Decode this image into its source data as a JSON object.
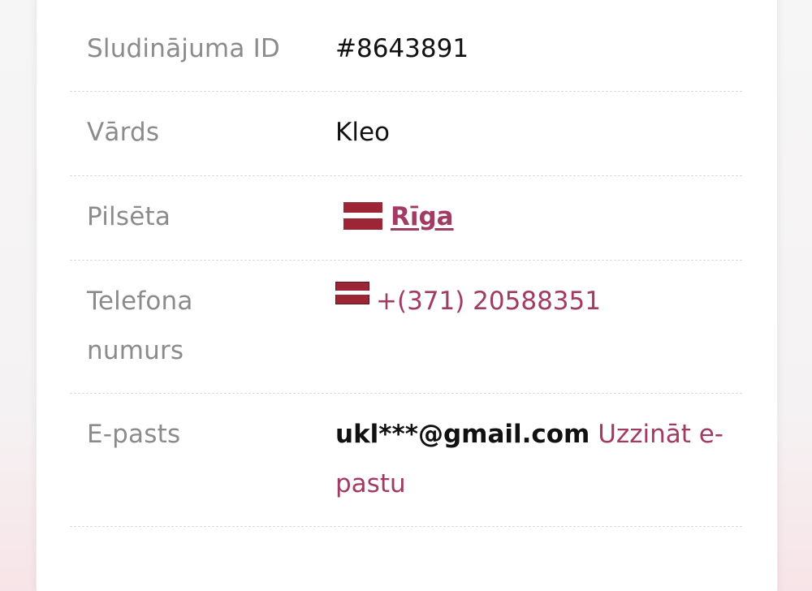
{
  "details": {
    "listing_id": {
      "label": "Sludinājuma ID",
      "value": "#8643891"
    },
    "name": {
      "label": "Vārds",
      "value": "Kleo"
    },
    "city": {
      "label": "Pilsēta",
      "value": "Rīga",
      "flag_icon": "latvia-flag-icon"
    },
    "phone": {
      "label_line1": "Telefona",
      "label_line2": "numurs",
      "value": "+(371) 20588351",
      "flag_icon": "latvia-flag-icon"
    },
    "email": {
      "label": "E-pasts",
      "value": "ukl***@gmail.com",
      "reveal_line1": "Uzzināt e-",
      "reveal_line2": "pastu"
    }
  },
  "colors": {
    "accent": "#a23b63",
    "label": "#8b8b8b",
    "value": "#111111",
    "flag_red": "#9c2536"
  }
}
